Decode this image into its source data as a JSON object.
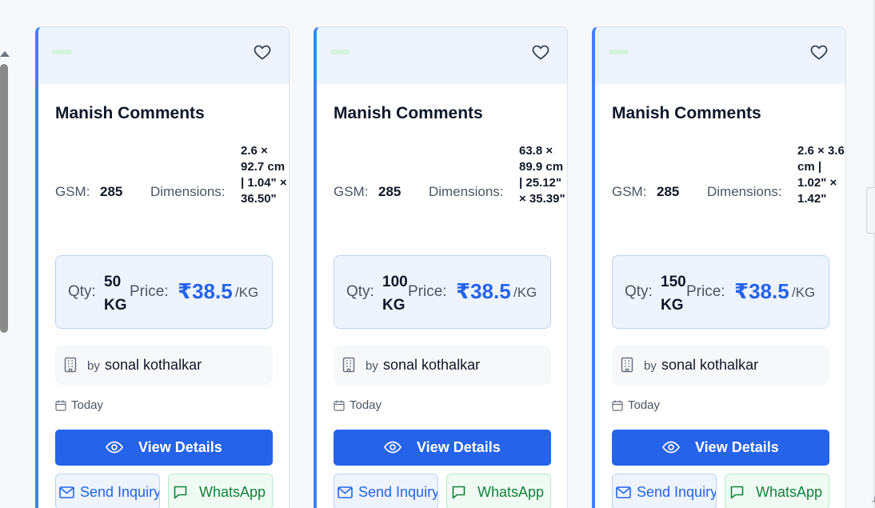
{
  "cards": [
    {
      "title": "Manish Comments",
      "gsm_label": "GSM:",
      "gsm": "285",
      "dimensions_label": "Dimensions:",
      "dimensions": "2.6 × 92.7 cm | 1.04\" × 36.50\"",
      "qty_label": "Qty:",
      "qty": "50 KG",
      "price_label": "Price:",
      "price": "₹38.5",
      "price_unit": "/KG",
      "seller_prefix": "by",
      "seller": "sonal kothalkar",
      "date": "Today",
      "view_label": "View Details",
      "inquiry_label": "Send Inquiry",
      "whatsapp_label": "WhatsApp"
    },
    {
      "title": "Manish Comments",
      "gsm_label": "GSM:",
      "gsm": "285",
      "dimensions_label": "Dimensions:",
      "dimensions": "63.8 × 89.9 cm | 25.12\" × 35.39\"",
      "qty_label": "Qty:",
      "qty": "100 KG",
      "price_label": "Price:",
      "price": "₹38.5",
      "price_unit": "/KG",
      "seller_prefix": "by",
      "seller": "sonal kothalkar",
      "date": "Today",
      "view_label": "View Details",
      "inquiry_label": "Send Inquiry",
      "whatsapp_label": "WhatsApp"
    },
    {
      "title": "Manish Comments",
      "gsm_label": "GSM:",
      "gsm": "285",
      "dimensions_label": "Dimensions:",
      "dimensions": "2.6 × 3.6 cm | 1.02\" × 1.42\"",
      "qty_label": "Qty:",
      "qty": "150 KG",
      "price_label": "Price:",
      "price": "₹38.5",
      "price_unit": "/KG",
      "seller_prefix": "by",
      "seller": "sonal kothalkar",
      "date": "Today",
      "view_label": "View Details",
      "inquiry_label": "Send Inquiry",
      "whatsapp_label": "WhatsApp"
    }
  ],
  "icons": {
    "favorite": "heart-icon",
    "seller": "building-icon",
    "date": "calendar-icon",
    "view": "eye-icon",
    "inquiry": "mail-icon",
    "whatsapp": "chat-icon"
  },
  "colors": {
    "primary": "#2563eb",
    "accent_border": "#3b82f6",
    "price_box_bg": "#eef4fe",
    "whatsapp_green": "#15803d",
    "header_bg": "#eef3fd"
  }
}
